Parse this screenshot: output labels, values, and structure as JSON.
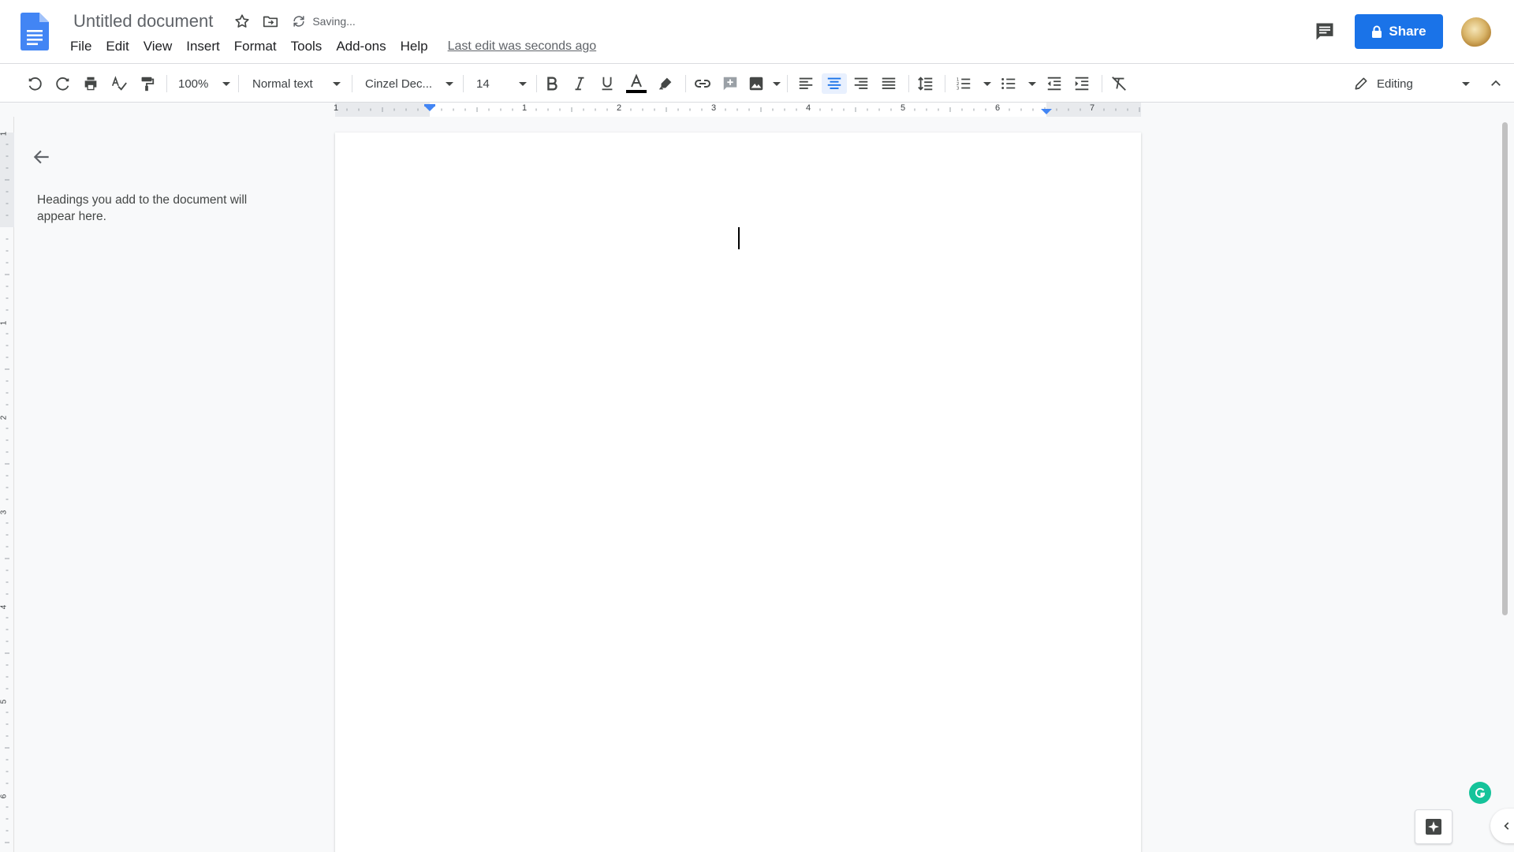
{
  "app": {
    "title": "Untitled document",
    "save_status": "Saving...",
    "last_edit": "Last edit was seconds ago",
    "accent_color": "#1a73e8"
  },
  "menu": [
    "File",
    "Edit",
    "View",
    "Insert",
    "Format",
    "Tools",
    "Add-ons",
    "Help"
  ],
  "header": {
    "share_label": "Share",
    "icons": [
      "star-icon",
      "move-to-folder-icon",
      "sync-icon",
      "comments-icon",
      "lock-icon"
    ]
  },
  "toolbar": {
    "zoom": "100%",
    "paragraph_style": "Normal text",
    "font": "Cinzel Dec...",
    "font_size": "14",
    "text_color": "#000000",
    "active_alignment": "center",
    "mode": "Editing"
  },
  "ruler": {
    "horizontal_labels": [
      "1",
      "1",
      "2",
      "3",
      "4",
      "5",
      "6",
      "7"
    ],
    "vertical_labels": [
      "1",
      "1",
      "2",
      "3",
      "4",
      "5",
      "6"
    ]
  },
  "outline": {
    "hint": "Headings you add to the document will appear here."
  }
}
